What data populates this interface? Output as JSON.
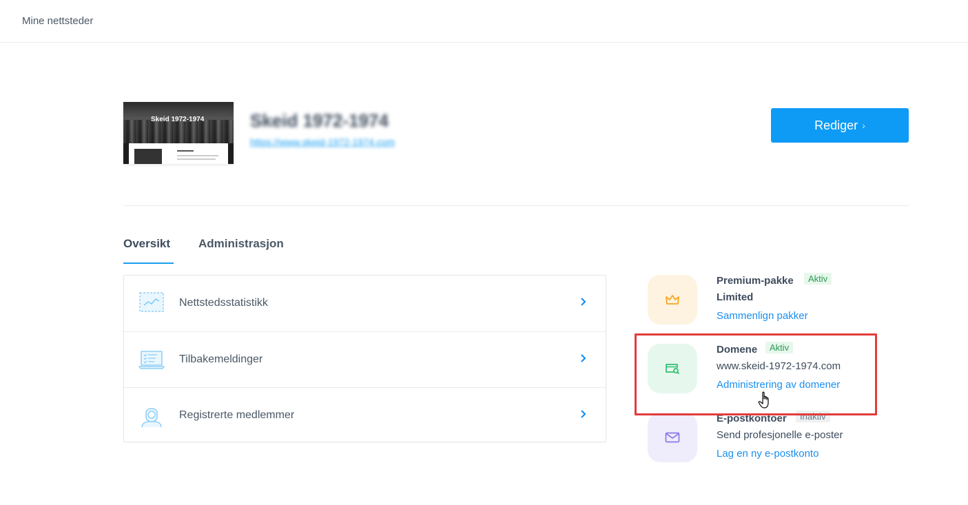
{
  "topbar": {
    "breadcrumb": "Mine nettsteder"
  },
  "site": {
    "name": "Skeid 1972-1974",
    "url": "https://www.skeid-1972-1974.com",
    "thumbnail_title": "Skeid 1972-1974",
    "edit_label": "Rediger",
    "edit_chevron": "›"
  },
  "tabs": [
    {
      "label": "Oversikt",
      "active": true
    },
    {
      "label": "Administrasjon",
      "active": false
    }
  ],
  "overview_items": [
    {
      "label": "Nettstedsstatistikk",
      "icon": "chart-icon"
    },
    {
      "label": "Tilbakemeldinger",
      "icon": "laptop-checklist-icon"
    },
    {
      "label": "Registrerte medlemmer",
      "icon": "member-icon"
    }
  ],
  "features": {
    "premium": {
      "title": "Premium-pakke",
      "badge": "Aktiv",
      "desc": "Limited",
      "link": "Sammenlign pakker",
      "icon": "crown-icon",
      "color": "#f5a623",
      "bg": "#fdf3e0"
    },
    "domain": {
      "title": "Domene",
      "badge": "Aktiv",
      "desc": "www.skeid-1972-1974.com",
      "link": "Administrering av domener",
      "icon": "domain-search-icon",
      "color": "#2fbf71",
      "bg": "#e6f8ee"
    },
    "email": {
      "title": "E-postkontoer",
      "badge": "Inaktiv",
      "desc": "Send profesjonelle e-poster",
      "link": "Lag en ny e-postkonto",
      "icon": "mail-icon",
      "color": "#8a78e8",
      "bg": "#efecfc"
    }
  },
  "colors": {
    "primary": "#0d9bf5",
    "link": "#1a8ff0",
    "highlight": "#e23c3c"
  }
}
